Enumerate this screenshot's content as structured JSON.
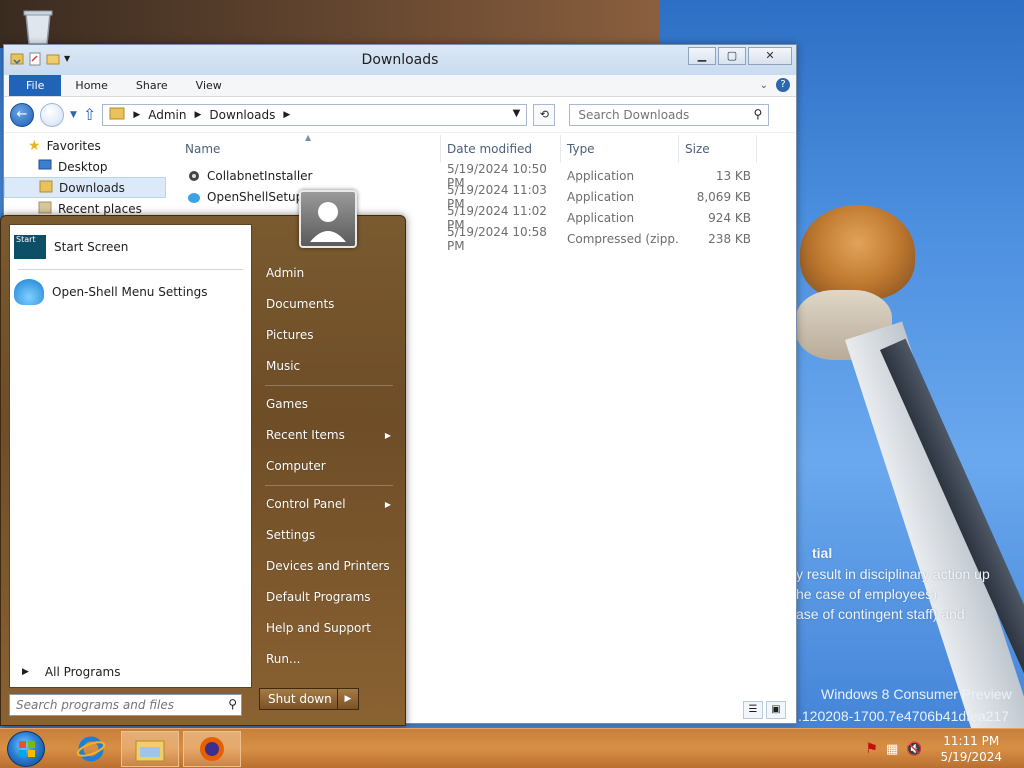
{
  "explorer": {
    "title": "Downloads",
    "ribbon_tabs": [
      "File",
      "Home",
      "Share",
      "View"
    ],
    "breadcrumb": [
      "Admin",
      "Downloads"
    ],
    "search_placeholder": "Search Downloads",
    "nav": {
      "favorites": "Favorites",
      "desktop": "Desktop",
      "downloads": "Downloads",
      "recent": "Recent places"
    },
    "columns": [
      "Name",
      "Date modified",
      "Type",
      "Size"
    ],
    "files": [
      {
        "name": "CollabnetInstaller",
        "date": "5/19/2024 10:50 PM",
        "type": "Application",
        "size": "13 KB"
      },
      {
        "name": "OpenShellSetup_4",
        "date": "5/19/2024 11:03 PM",
        "type": "Application",
        "size": "8,069 KB"
      },
      {
        "name": "",
        "date": "5/19/2024 11:02 PM",
        "type": "Application",
        "size": "924 KB"
      },
      {
        "name": "",
        "date": "5/19/2024 10:58 PM",
        "type": "Compressed (zipp...",
        "size": "238 KB"
      }
    ]
  },
  "startmenu": {
    "left_items": [
      "Start Screen",
      "Open-Shell Menu Settings"
    ],
    "start_tile_text": "Start",
    "all_programs": "All Programs",
    "search_placeholder": "Search programs and files",
    "right_items": [
      {
        "label": "Admin",
        "arrow": false
      },
      {
        "label": "Documents",
        "arrow": false
      },
      {
        "label": "Pictures",
        "arrow": false
      },
      {
        "label": "Music",
        "arrow": false
      },
      {
        "label": "Games",
        "arrow": false
      },
      {
        "label": "Recent Items",
        "arrow": true
      },
      {
        "label": "Computer",
        "arrow": false
      },
      {
        "label": "Control Panel",
        "arrow": true
      },
      {
        "label": "Settings",
        "arrow": false
      },
      {
        "label": "Devices and Printers",
        "arrow": false
      },
      {
        "label": "Default Programs",
        "arrow": false
      },
      {
        "label": "Help and Support",
        "arrow": false
      },
      {
        "label": "Run...",
        "arrow": false
      }
    ],
    "shutdown_label": "Shut down"
  },
  "desktop": {
    "watermark_title": "tial",
    "watermark_lines": [
      "y result in disciplinary action up",
      "he case of employees)",
      "ase of contingent staff) and"
    ],
    "build_line1": "Windows 8 Consumer Preview",
    "build_line2": ".120208-1700.7e4706b41dfea217"
  },
  "taskbar": {
    "time": "11:11 PM",
    "date": "5/19/2024"
  },
  "colors": {
    "accent": "#1f64b8",
    "startmenu_bg": "#7a5a2f",
    "taskbar_bg": "#d88f45"
  }
}
